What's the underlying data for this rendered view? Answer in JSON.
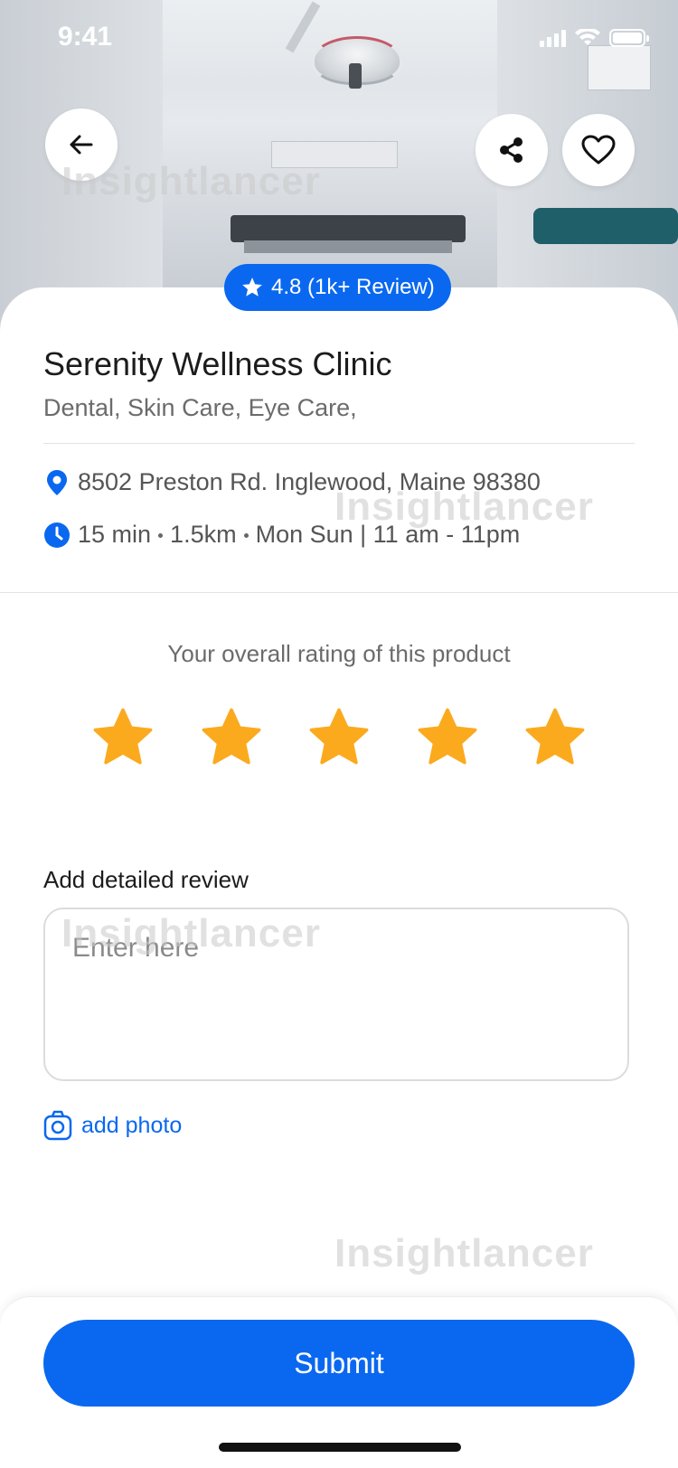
{
  "status_bar": {
    "time": "9:41"
  },
  "header": {
    "watermark_text": "Insightlancer"
  },
  "rating_badge": {
    "text": "4.8 (1k+ Review)"
  },
  "clinic": {
    "name": "Serenity Wellness Clinic",
    "tags": "Dental, Skin Care, Eye Care,",
    "address": "8502 Preston Rd. Inglewood, Maine 98380",
    "distance_time": "15 min",
    "distance_km": "1.5km",
    "hours": "Mon Sun | 11 am - 11pm"
  },
  "rating_section": {
    "prompt": "Your overall rating of this product",
    "stars": 5,
    "star_color": "#FBAA1E"
  },
  "review": {
    "label": "Add detailed review",
    "placeholder": "Enter here",
    "add_photo_label": "add photo"
  },
  "submit_label": "Submit",
  "colors": {
    "primary": "#0A68F0",
    "star": "#FBAA1E"
  }
}
